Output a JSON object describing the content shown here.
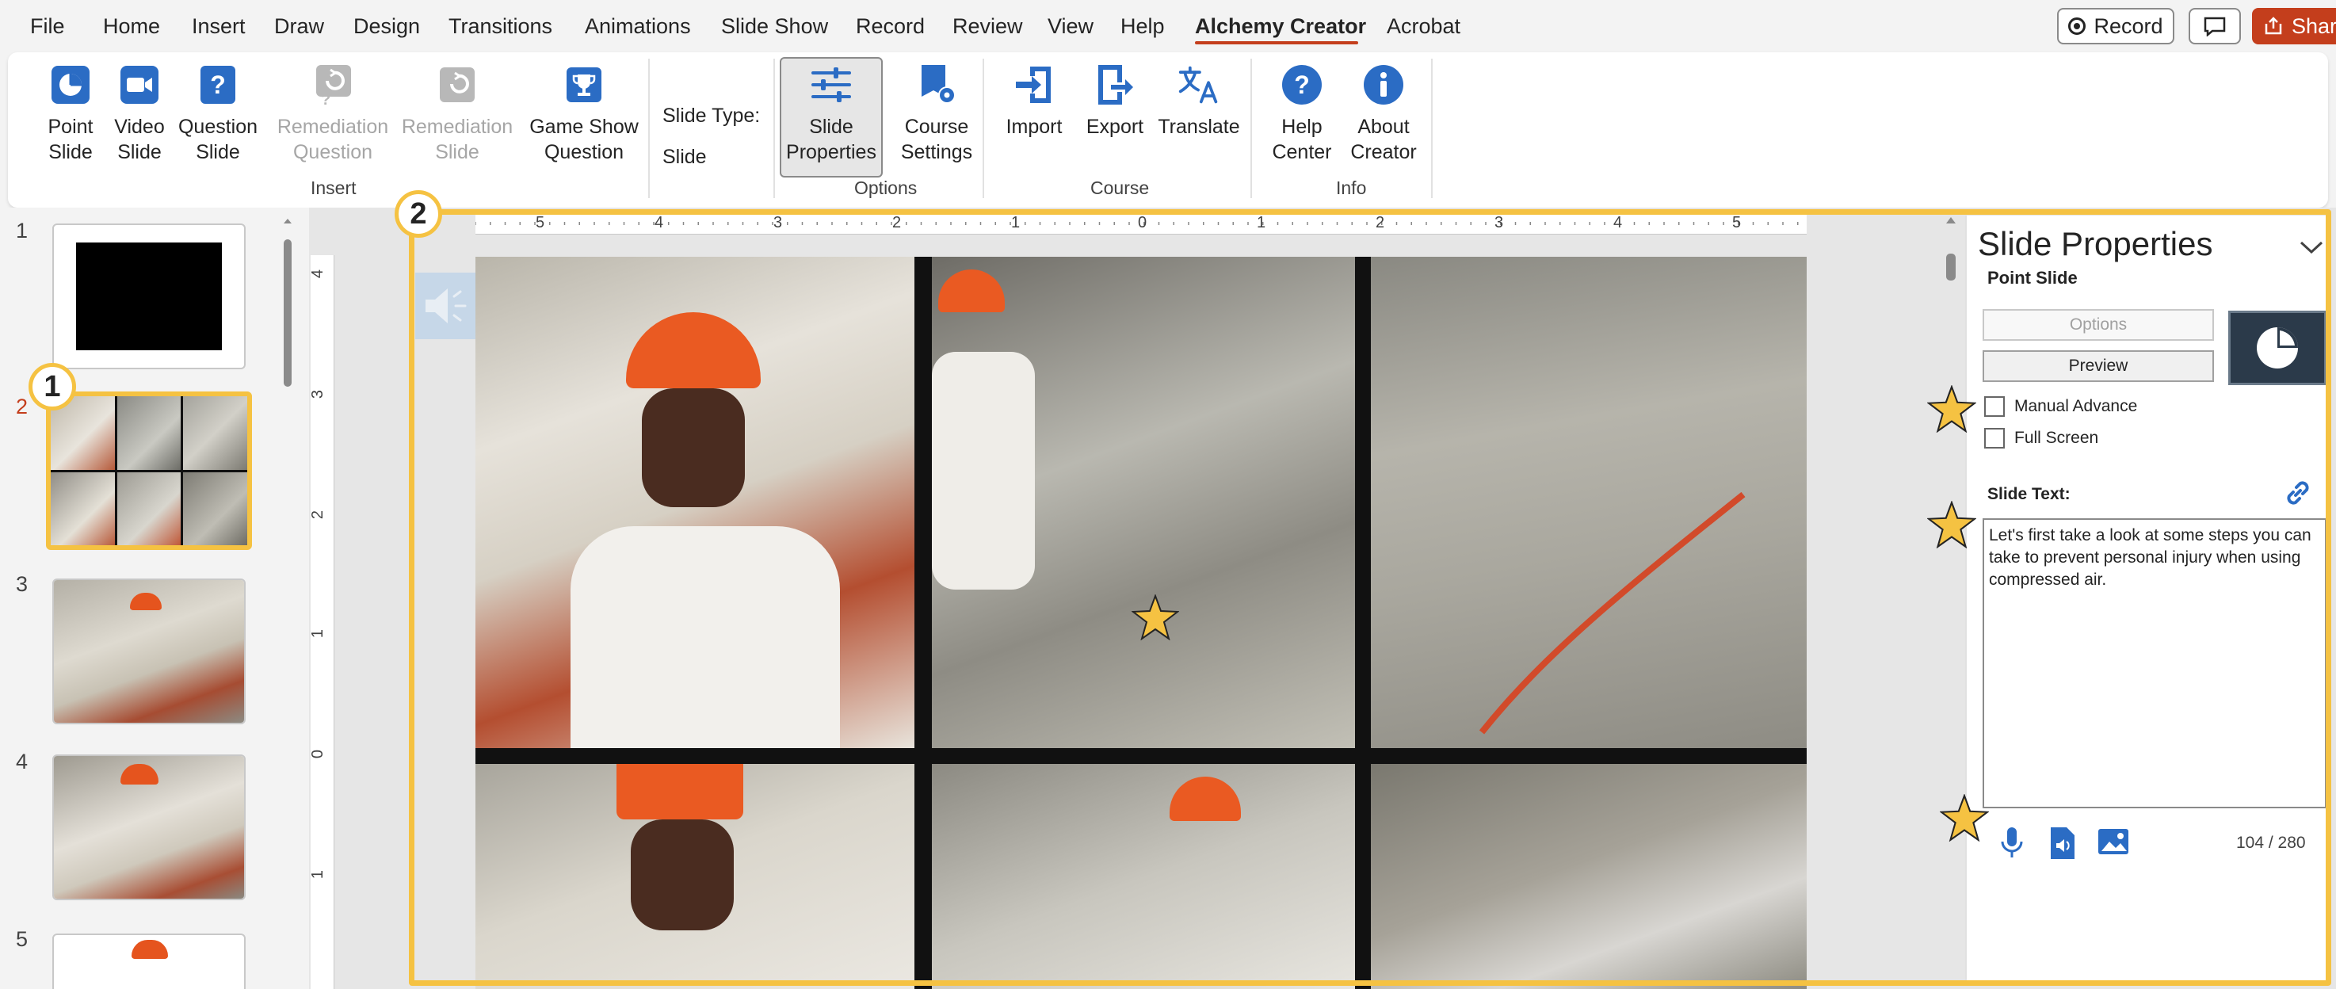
{
  "menu": {
    "items": [
      "File",
      "Home",
      "Insert",
      "Draw",
      "Design",
      "Transitions",
      "Animations",
      "Slide Show",
      "Record",
      "Review",
      "View",
      "Help",
      "Alchemy Creator",
      "Acrobat"
    ],
    "active": "Alchemy Creator",
    "record_label": "Record",
    "share_label": "Share"
  },
  "ribbon": {
    "buttons": {
      "point_slide": "Point Slide",
      "video_slide": "Video Slide",
      "question_slide": "Question Slide",
      "remediation_question": "Remediation Question",
      "remediation_slide": "Remediation Slide",
      "game_show_question": "Game Show Question",
      "slide_properties": "Slide Properties",
      "course_settings": "Course Settings",
      "import": "Import",
      "export": "Export",
      "translate": "Translate",
      "help_center": "Help Center",
      "about_creator": "About Creator"
    },
    "slide_type_label": "Slide Type:",
    "slide_type_value": "Slide",
    "groups": {
      "insert": "Insert",
      "options": "Options",
      "course": "Course",
      "info": "Info"
    }
  },
  "thumbnails": {
    "numbers": [
      "1",
      "2",
      "3",
      "4",
      "5"
    ],
    "selected": "2"
  },
  "badges": {
    "one": "1",
    "two": "2"
  },
  "ruler": {
    "top": [
      "5",
      "4",
      "3",
      "2",
      "1",
      "0",
      "1",
      "2",
      "3",
      "4",
      "5"
    ],
    "left": [
      "4",
      "3",
      "2",
      "1",
      "0",
      "1"
    ]
  },
  "properties": {
    "title": "Slide Properties",
    "subtitle": "Point Slide",
    "options_label": "Options",
    "preview_label": "Preview",
    "manual_advance": "Manual Advance",
    "full_screen": "Full Screen",
    "slide_text_label": "Slide Text:",
    "slide_text": "Let's first take a look at some steps you can take to prevent personal injury when using compressed air.",
    "char_count": "104 / 280"
  },
  "colors": {
    "accent": "#c43e1c",
    "highlight": "#f5c242",
    "ribbon_icon": "#2b6cc4"
  }
}
